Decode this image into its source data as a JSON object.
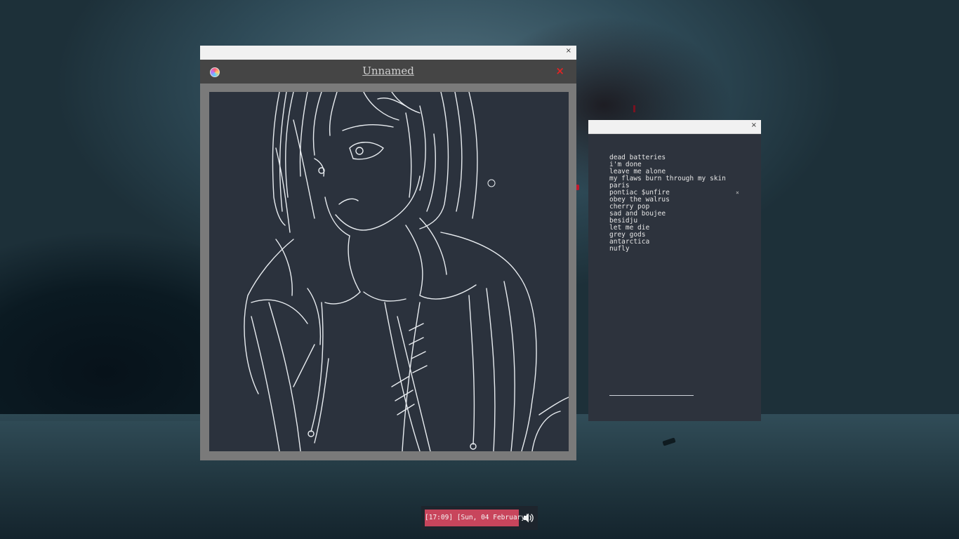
{
  "paint_window": {
    "title": "Unnamed",
    "wm_close_glyph": "×",
    "close_glyph": "×",
    "logo_icon": "palette-logo-icon",
    "canvas_background": "#2b323d",
    "close_color": "#e02424"
  },
  "player_window": {
    "wm_close_glyph": "×",
    "active_marker": "×",
    "active_index": 5,
    "tracks": [
      "dead batteries",
      "i'm done",
      "leave me alone",
      "my flaws burn through my skin",
      "paris",
      "pontiac $unfire",
      "obey the walrus",
      "cherry pop",
      "sad and boujee",
      "besidju",
      "let me die",
      "grey gods",
      "antarctica",
      "nufly"
    ]
  },
  "statusbar": {
    "clock": "[17:09] [Sun, 04 February]",
    "volume_icon": "speaker-volume-icon",
    "accent": "#c8455c"
  }
}
